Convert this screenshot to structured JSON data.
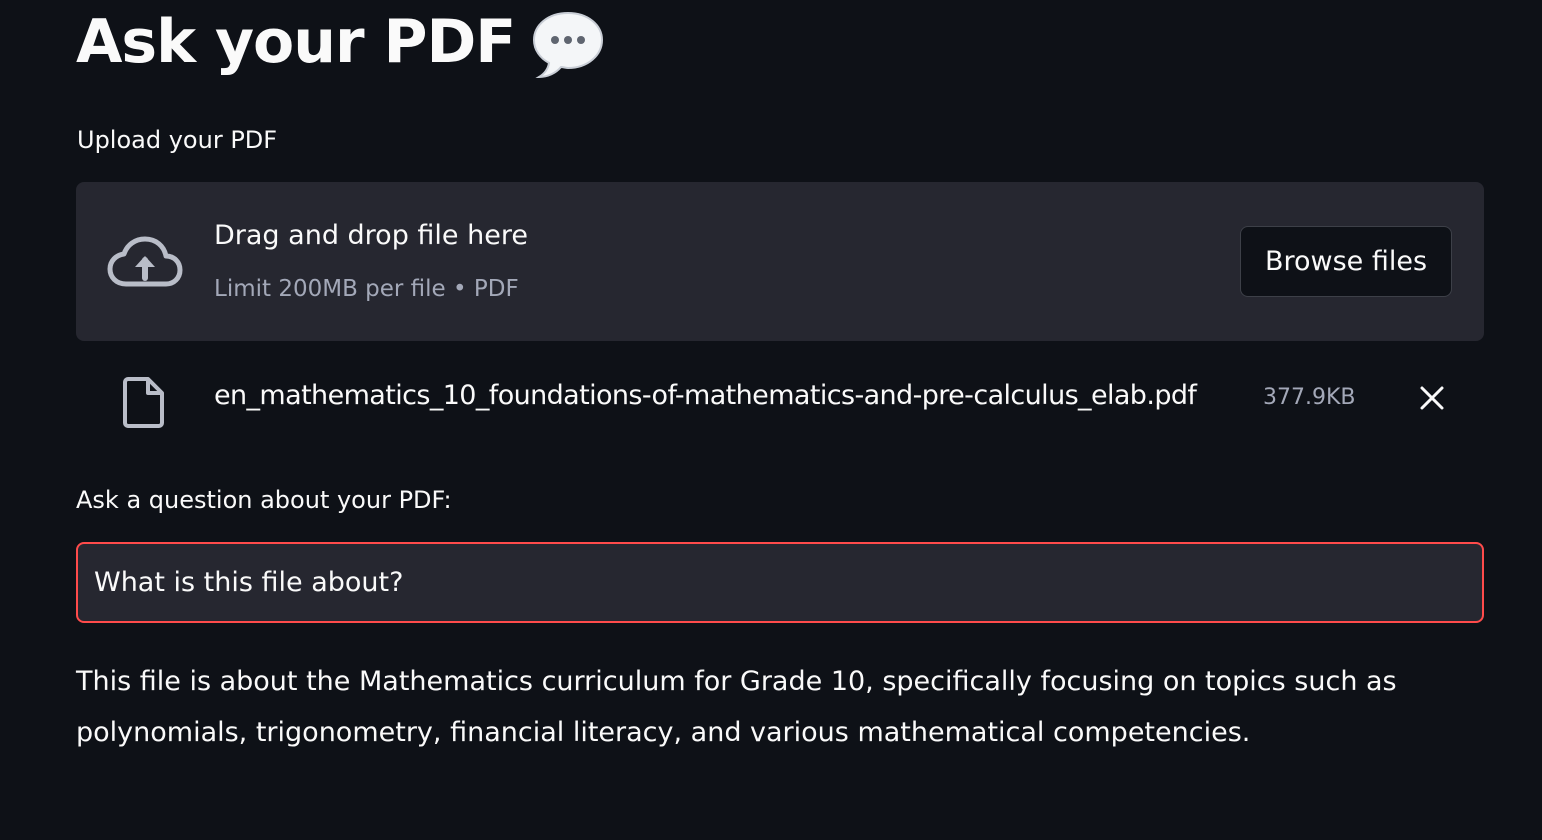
{
  "header": {
    "title": "Ask your PDF",
    "title_emoji": "speech-bubble-icon"
  },
  "uploader": {
    "label": "Upload your PDF",
    "drop_text": "Drag and drop file here",
    "limit_text": "Limit 200MB per file • PDF",
    "browse_label": "Browse files",
    "upload_icon": "cloud-upload-icon"
  },
  "uploaded_file": {
    "name": "en_mathematics_10_foundations-of-mathematics-and-pre-calculus_elab.pdf",
    "size": "377.9KB",
    "file_icon": "file-icon",
    "remove_icon": "close-icon"
  },
  "question": {
    "label": "Ask a question about your PDF:",
    "value": "What is this file about?"
  },
  "answer": {
    "text": "This file is about the Mathematics curriculum for Grade 10, specifically focusing on topics such as polynomials, trigonometry, financial literacy, and various mathematical competencies."
  },
  "colors": {
    "background": "#0e1117",
    "surface": "#262730",
    "text": "#fafafa",
    "muted_text": "#a3a8b8",
    "focus_border": "#ff4b4b"
  }
}
